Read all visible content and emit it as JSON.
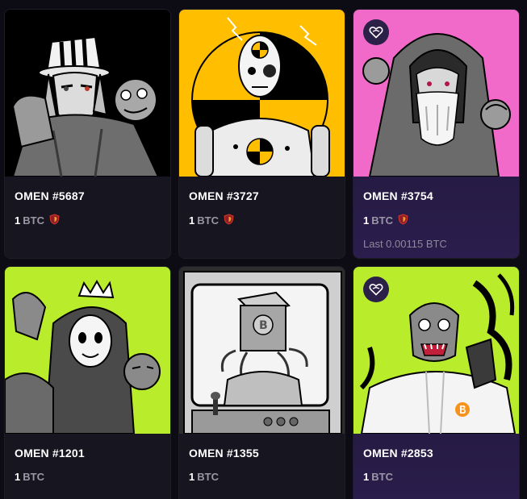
{
  "colors": {
    "page_bg": "#0d0b13",
    "card_bg": "#17151f",
    "art_yellow": "#ffbf00",
    "art_pink": "#f16ac9",
    "art_lime": "#b9ec2a",
    "accent_purple": "#2b1d4d"
  },
  "cards": [
    {
      "title": "OMEN #5687",
      "amount": "1",
      "currency": "BTC",
      "shield": true,
      "last": "",
      "art_bg": "#000000",
      "icons": []
    },
    {
      "title": "OMEN #3727",
      "amount": "1",
      "currency": "BTC",
      "shield": true,
      "last": "",
      "art_bg": "#ffbf00",
      "icons": []
    },
    {
      "title": "OMEN #3754",
      "amount": "1",
      "currency": "BTC",
      "shield": true,
      "last": "Last 0.00115 BTC",
      "art_bg": "#f16ac9",
      "icons": [
        "heart-badge-icon"
      ]
    },
    {
      "title": "OMEN #1201",
      "amount": "1",
      "currency": "BTC",
      "shield": false,
      "last": "",
      "art_bg": "#b9ec2a",
      "icons": []
    },
    {
      "title": "OMEN #1355",
      "amount": "1",
      "currency": "BTC",
      "shield": false,
      "last": "",
      "art_bg": "#dcdcdc",
      "icons": []
    },
    {
      "title": "OMEN #2853",
      "amount": "1",
      "currency": "BTC",
      "shield": false,
      "last": "",
      "art_bg": "#b9ec2a",
      "icons": [
        "heart-badge-icon",
        "bitcoin-icon"
      ]
    }
  ]
}
